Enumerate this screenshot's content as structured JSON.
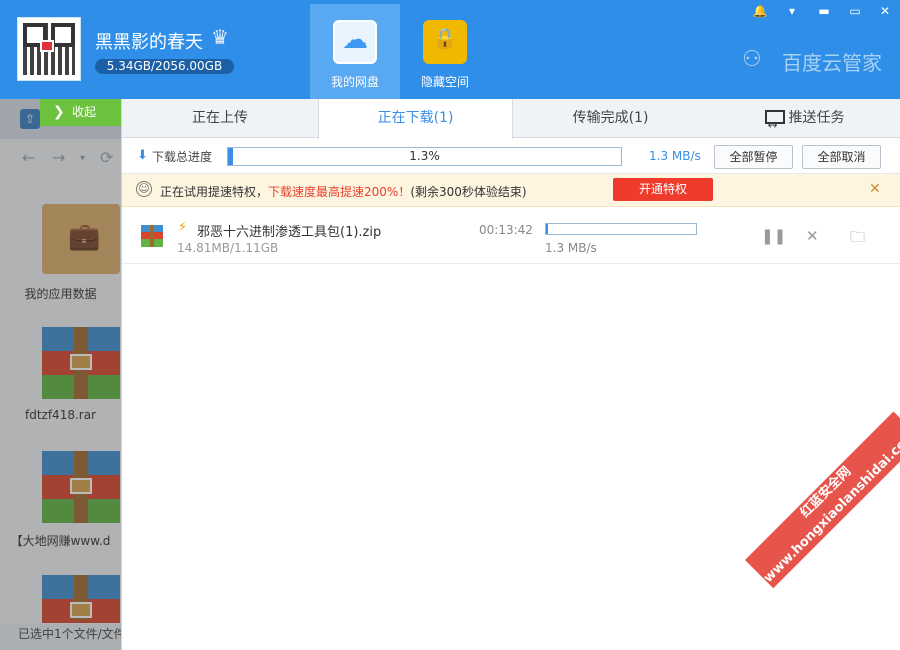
{
  "header": {
    "username": "黑黑影的春天",
    "quota": "5.34GB/2056.00GB",
    "nav_tabs": [
      {
        "label": "我的网盘",
        "icon": "cloud-icon"
      },
      {
        "label": "隐藏空间",
        "icon": "lock-icon"
      }
    ],
    "brand": "百度云管家",
    "window_controls": [
      "bell-icon",
      "menu-icon",
      "minimize-icon",
      "maximize-icon",
      "close-icon"
    ]
  },
  "sidebar": {
    "collapse_label": "收起",
    "files": [
      {
        "name": "我的应用数据",
        "type": "folder"
      },
      {
        "name": "fdtzf418.rar",
        "type": "rar"
      },
      {
        "name": "【大地网赚www.d",
        "type": "rar"
      },
      {
        "name": "",
        "type": "rar"
      }
    ],
    "status": "已选中1个文件/文件"
  },
  "transfer": {
    "tabs": [
      {
        "label": "正在上传"
      },
      {
        "label": "正在下载(1)"
      },
      {
        "label": "传输完成(1)"
      },
      {
        "label": "推送任务"
      }
    ],
    "active_tab": 1,
    "total_label": "下载总进度",
    "total_percent": "1.3%",
    "total_progress": 0.013,
    "total_speed": "1.3 MB/s",
    "pause_all": "全部暂停",
    "cancel_all": "全部取消"
  },
  "promo": {
    "text_a": "正在试用提速特权，",
    "text_highlight": "下载速度最高提速200%！",
    "text_b": "(剩余300秒体验结束)",
    "button": "开通特权"
  },
  "tasks": [
    {
      "name": "邪恶十六进制渗透工具包(1).zip",
      "size": "14.81MB/1.11GB",
      "time_left": "00:13:42",
      "progress": 0.013,
      "speed": "1.3 MB/s"
    }
  ],
  "watermark": "红蓝安全网 www.hongxiaolanshidai.com"
}
